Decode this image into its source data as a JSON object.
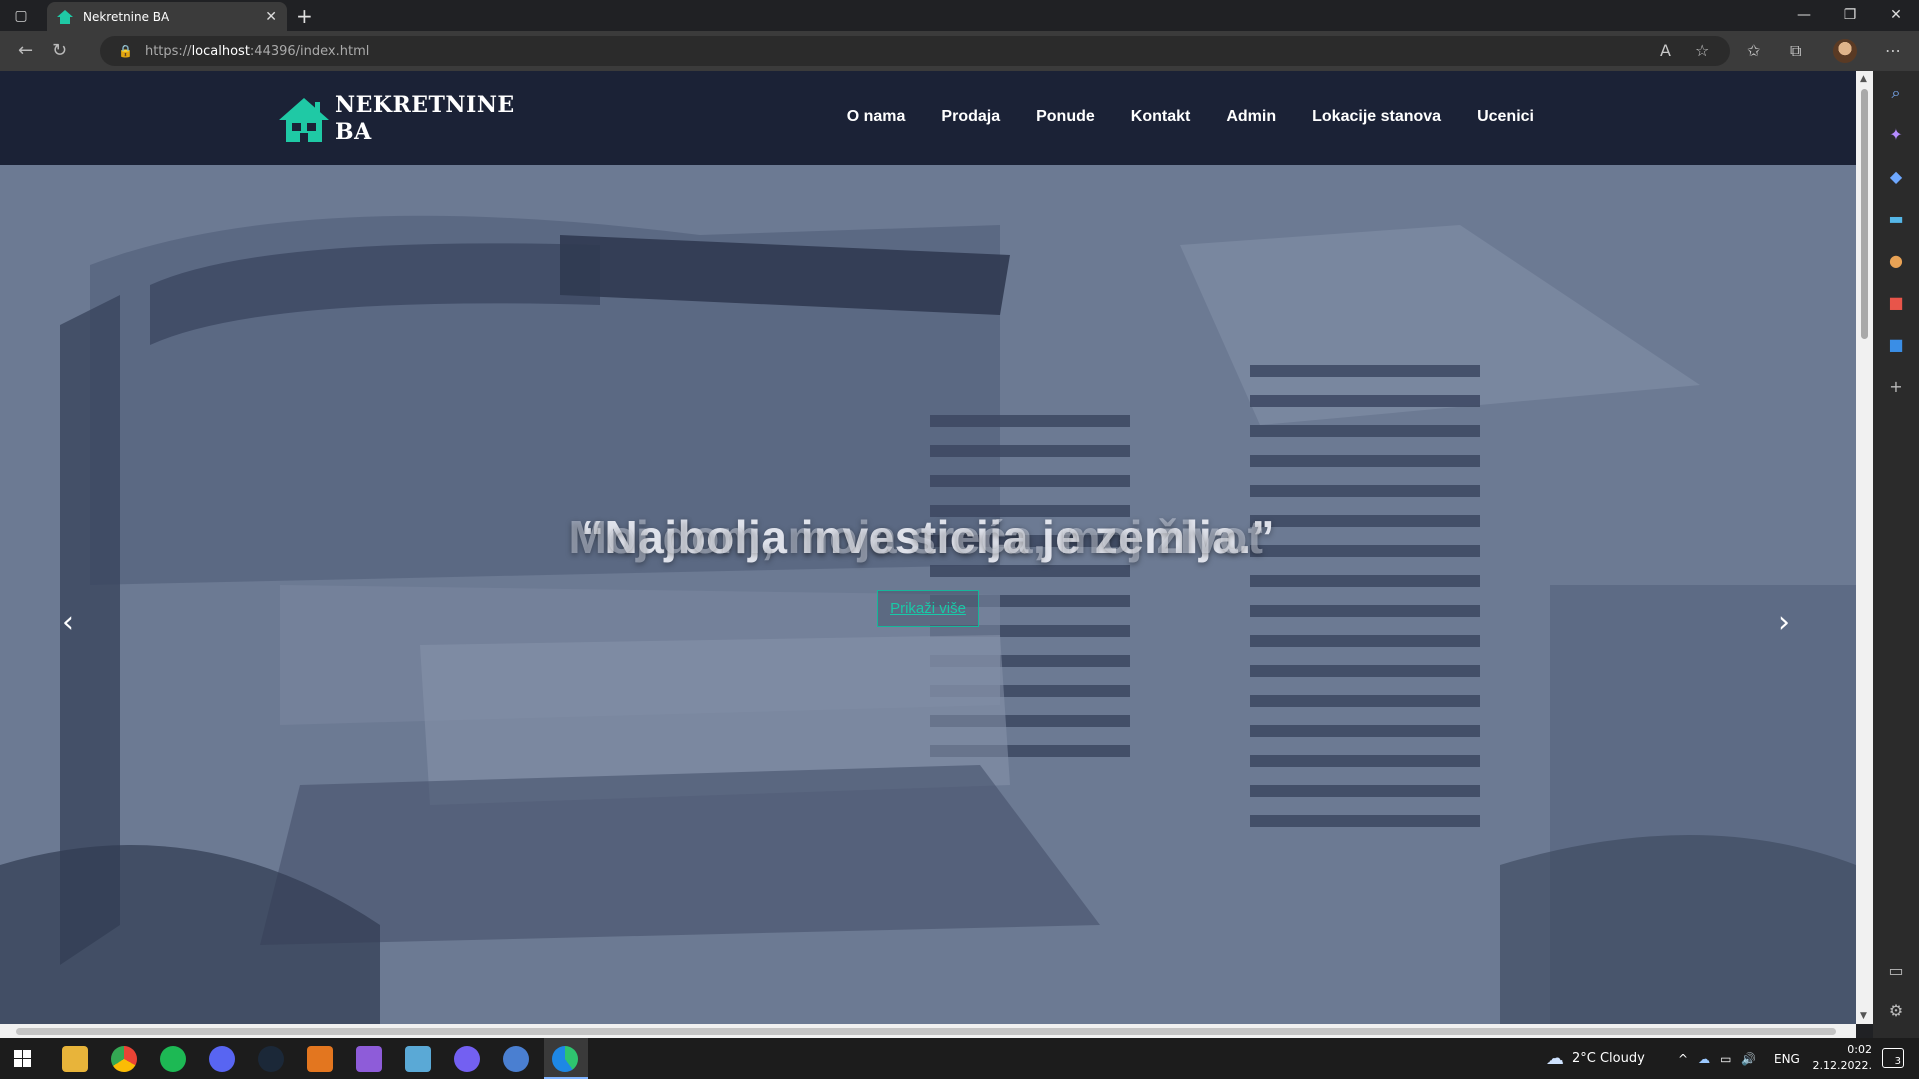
{
  "browser": {
    "tab_title": "Nekretnine BA",
    "url_prefix": "https://",
    "url_host": "localhost",
    "url_rest": ":44396/index.html"
  },
  "site": {
    "logo_line1": "NEKRETNINE",
    "logo_line2": "BA",
    "nav": [
      "O nama",
      "Prodaja",
      "Ponude",
      "Kontakt",
      "Admin",
      "Lokacije stanova",
      "Ucenici"
    ],
    "hero": {
      "title": "“Najbolja investicija je zemlja.”",
      "ghost_title": "Moj dom, moja sreća, moj život",
      "button": "Prikaži više",
      "prev": "‹",
      "next": "›"
    }
  },
  "taskbar": {
    "weather": "2°C  Cloudy",
    "lang": "ENG",
    "time": "0:02",
    "date": "2.12.2022.",
    "notifications": "3"
  },
  "colors": {
    "accent": "#1fc9a5",
    "header_bg": "#1b2236"
  }
}
